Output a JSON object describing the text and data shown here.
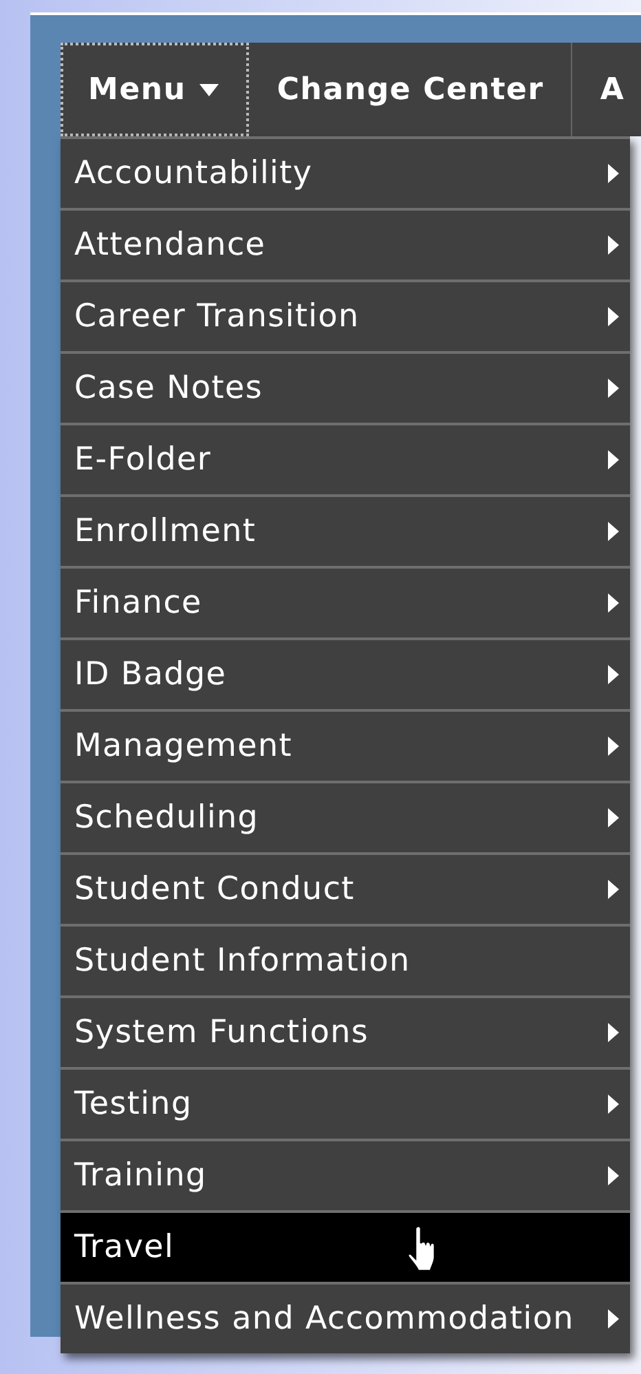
{
  "menu_bar": [
    {
      "label": "Menu",
      "kind": "dropdown",
      "focused": true
    },
    {
      "label": "Change Center",
      "kind": "link",
      "focused": false
    },
    {
      "label": "A",
      "kind": "link",
      "focused": false
    }
  ],
  "menu": {
    "items": [
      {
        "label": "Accountability",
        "has_submenu": true,
        "selected": false
      },
      {
        "label": "Attendance",
        "has_submenu": true,
        "selected": false
      },
      {
        "label": "Career Transition",
        "has_submenu": true,
        "selected": false
      },
      {
        "label": "Case Notes",
        "has_submenu": true,
        "selected": false
      },
      {
        "label": "E-Folder",
        "has_submenu": true,
        "selected": false
      },
      {
        "label": "Enrollment",
        "has_submenu": true,
        "selected": false
      },
      {
        "label": "Finance",
        "has_submenu": true,
        "selected": false
      },
      {
        "label": "ID Badge",
        "has_submenu": true,
        "selected": false
      },
      {
        "label": "Management",
        "has_submenu": true,
        "selected": false
      },
      {
        "label": "Scheduling",
        "has_submenu": true,
        "selected": false
      },
      {
        "label": "Student Conduct",
        "has_submenu": true,
        "selected": false
      },
      {
        "label": "Student Information",
        "has_submenu": false,
        "selected": false
      },
      {
        "label": "System Functions",
        "has_submenu": true,
        "selected": false
      },
      {
        "label": "Testing",
        "has_submenu": true,
        "selected": false
      },
      {
        "label": "Training",
        "has_submenu": true,
        "selected": false
      },
      {
        "label": "Travel",
        "has_submenu": false,
        "selected": true
      },
      {
        "label": "Wellness and Accommodation",
        "has_submenu": true,
        "selected": false
      }
    ]
  }
}
